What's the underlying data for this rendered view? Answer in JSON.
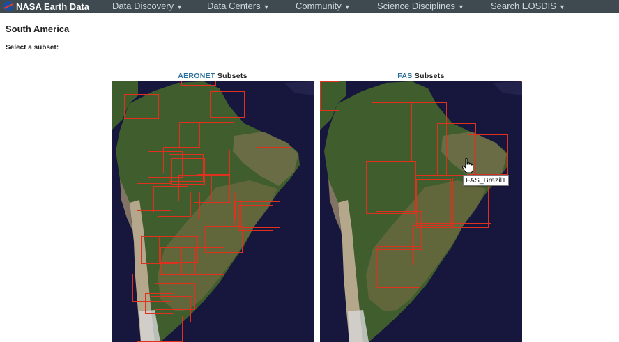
{
  "header": {
    "brand": "NASA Earth Data",
    "nav": [
      {
        "label": "Data Discovery",
        "caret": "▼"
      },
      {
        "label": "Data Centers",
        "caret": "▼"
      },
      {
        "label": "Community",
        "caret": "▼"
      },
      {
        "label": "Science Disciplines",
        "caret": "▼"
      },
      {
        "label": "Search EOSDIS",
        "caret": "▼"
      }
    ]
  },
  "page": {
    "title": "South America",
    "prompt": "Select a subset:"
  },
  "panels": [
    {
      "acronym": "AERONET",
      "suffix": " Subsets"
    },
    {
      "acronym": "FAS",
      "suffix": " Subsets"
    }
  ],
  "tooltip": {
    "text": "FAS_Brazil1"
  },
  "colors": {
    "nav_bg": "#3e4a4f",
    "subset_outline": "#e0301e",
    "ocean": "#17173d",
    "acronym_link": "#2b6f9c"
  },
  "icons": {
    "logo": "nasa-meatball-icon",
    "cursor": "hand-pointer-icon",
    "caret": "caret-down-icon"
  }
}
